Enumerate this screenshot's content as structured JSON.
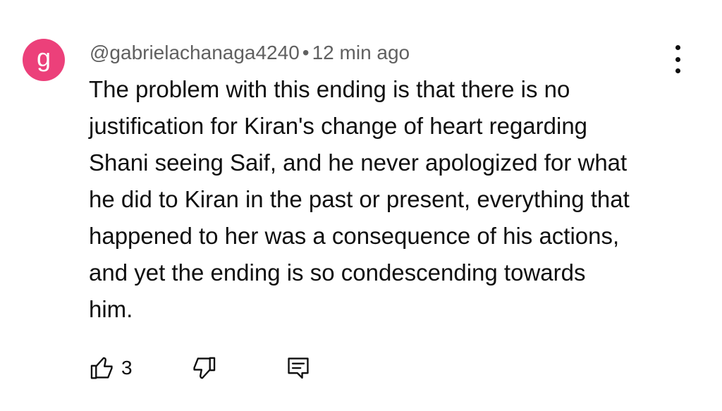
{
  "comment": {
    "avatar_letter": "g",
    "avatar_color": "#ec407a",
    "author": "@gabrielachanaga4240",
    "separator": "•",
    "time": "12 min ago",
    "text_lines": [
      "The problem with this ending is that there is no",
      "justification for Kiran's change of heart regarding",
      "Shani seeing Saif, and he never apologized for what",
      "he did to Kiran in the past or present, everything that",
      "happened to her was a consequence of his actions,",
      "and yet the ending is so condescending towards",
      "him."
    ],
    "like_count": "3",
    "icons": {
      "like": "thumbs-up-icon",
      "dislike": "thumbs-down-icon",
      "reply": "reply-comment-icon",
      "menu": "more-vertical-icon"
    }
  }
}
